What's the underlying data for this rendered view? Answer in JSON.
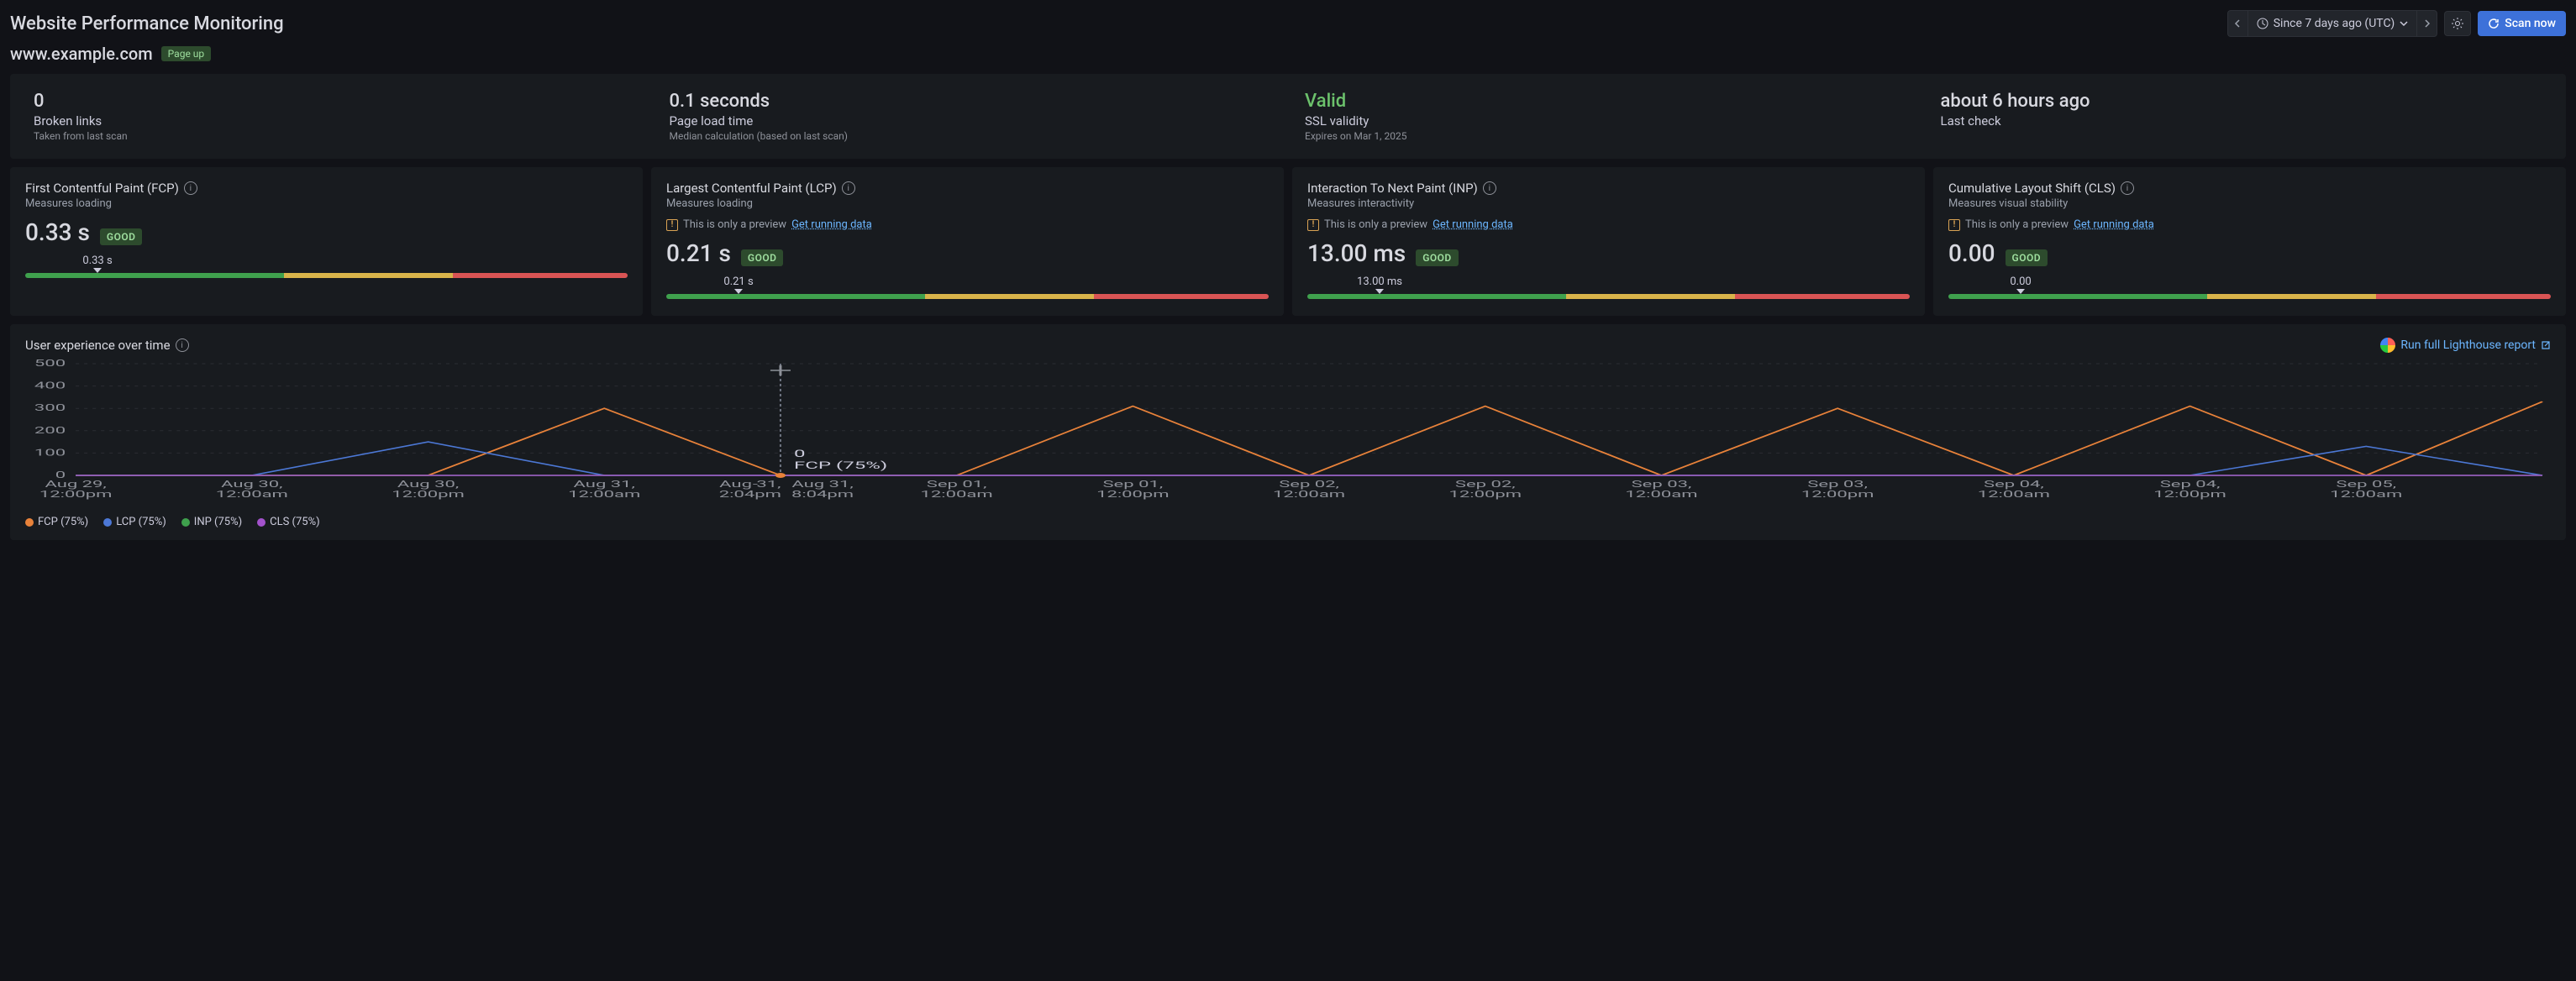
{
  "header": {
    "title": "Website Performance Monitoring",
    "time_range": "Since 7 days ago (UTC)",
    "scan_button": "Scan now"
  },
  "subheader": {
    "domain": "www.example.com",
    "status": "Page up"
  },
  "summary": {
    "broken_links": {
      "value": "0",
      "label": "Broken links",
      "sub": "Taken from last scan"
    },
    "page_load": {
      "value": "0.1 seconds",
      "label": "Page load time",
      "sub": "Median calculation (based on last scan)"
    },
    "ssl": {
      "value": "Valid",
      "label": "SSL validity",
      "sub": "Expires on Mar 1, 2025"
    },
    "last_check": {
      "value": "about 6 hours ago",
      "label": "Last check"
    }
  },
  "metrics": {
    "fcp": {
      "title": "First Contentful Paint (FCP)",
      "subtitle": "Measures loading",
      "value": "0.33 s",
      "badge": "GOOD",
      "gauge_label": "0.33 s",
      "marker_pct": 12,
      "segments": [
        43,
        28,
        29
      ]
    },
    "lcp": {
      "title": "Largest Contentful Paint (LCP)",
      "subtitle": "Measures loading",
      "preview_text": "This is only a preview",
      "preview_link": "Get running data",
      "value": "0.21 s",
      "badge": "GOOD",
      "gauge_label": "0.21 s",
      "marker_pct": 12,
      "segments": [
        43,
        28,
        29
      ]
    },
    "inp": {
      "title": "Interaction To Next Paint (INP)",
      "subtitle": "Measures interactivity",
      "preview_text": "This is only a preview",
      "preview_link": "Get running data",
      "value": "13.00 ms",
      "badge": "GOOD",
      "gauge_label": "13.00 ms",
      "marker_pct": 12,
      "segments": [
        43,
        28,
        29
      ]
    },
    "cls": {
      "title": "Cumulative Layout Shift (CLS)",
      "subtitle": "Measures visual stability",
      "preview_text": "This is only a preview",
      "preview_link": "Get running data",
      "value": "0.00",
      "badge": "GOOD",
      "gauge_label": "0.00",
      "marker_pct": 12,
      "segments": [
        43,
        28,
        29
      ]
    }
  },
  "chart": {
    "title": "User experience over time",
    "lighthouse_link": "Run full Lighthouse report",
    "tooltip": {
      "value": "0",
      "label": "FCP (75%)",
      "time_top": "Aug 31,",
      "time_bottom": "2:04pm"
    },
    "y_ticks": [
      "500",
      "400",
      "300",
      "200",
      "100",
      "0"
    ],
    "x_ticks": [
      "Aug 29,\n12:00pm",
      "Aug 30,\n12:00am",
      "Aug 30,\n12:00pm",
      "Aug 31,\n12:00am",
      "-",
      "Aug 31,\n8:04pm",
      "Sep 01,\n12:00am",
      "Sep 01,\n12:00pm",
      "Sep 02,\n12:00am",
      "Sep 02,\n12:00pm",
      "Sep 03,\n12:00am",
      "Sep 03,\n12:00pm",
      "Sep 04,\n12:00am",
      "Sep 04,\n12:00pm",
      "Sep 05,\n12:00am"
    ],
    "legend": [
      {
        "name": "FCP (75%)",
        "color": "#e8823a"
      },
      {
        "name": "LCP (75%)",
        "color": "#4c78d6"
      },
      {
        "name": "INP (75%)",
        "color": "#3fa14d"
      },
      {
        "name": "CLS (75%)",
        "color": "#a352cc"
      }
    ]
  },
  "chart_data": {
    "type": "line",
    "ylim": [
      0,
      500
    ],
    "ylabel": "",
    "x": [
      "Aug 29 12:00pm",
      "Aug 30 12:00am",
      "Aug 30 12:00pm",
      "Aug 31 12:00am",
      "Aug 31 2:04pm",
      "Aug 31 8:04pm",
      "Sep 01 12:00am",
      "Sep 01 12:00pm",
      "Sep 02 12:00am",
      "Sep 02 12:00pm",
      "Sep 03 12:00am",
      "Sep 03 12:00pm",
      "Sep 04 12:00am",
      "Sep 04 12:00pm",
      "Sep 05 12:00am"
    ],
    "series": [
      {
        "name": "FCP (75%)",
        "color": "#e8823a",
        "values": [
          0,
          0,
          0,
          300,
          0,
          0,
          310,
          0,
          310,
          0,
          300,
          0,
          310,
          0,
          330
        ]
      },
      {
        "name": "LCP (75%)",
        "color": "#4c78d6",
        "values": [
          0,
          0,
          150,
          0,
          0,
          0,
          0,
          0,
          0,
          0,
          0,
          0,
          0,
          130,
          0
        ]
      },
      {
        "name": "INP (75%)",
        "color": "#3fa14d",
        "values": [
          0,
          0,
          0,
          0,
          0,
          0,
          0,
          0,
          0,
          0,
          0,
          0,
          0,
          0,
          0
        ]
      },
      {
        "name": "CLS (75%)",
        "color": "#a352cc",
        "values": [
          0,
          0,
          0,
          0,
          0,
          0,
          0,
          0,
          0,
          0,
          0,
          0,
          0,
          0,
          0
        ]
      }
    ]
  }
}
